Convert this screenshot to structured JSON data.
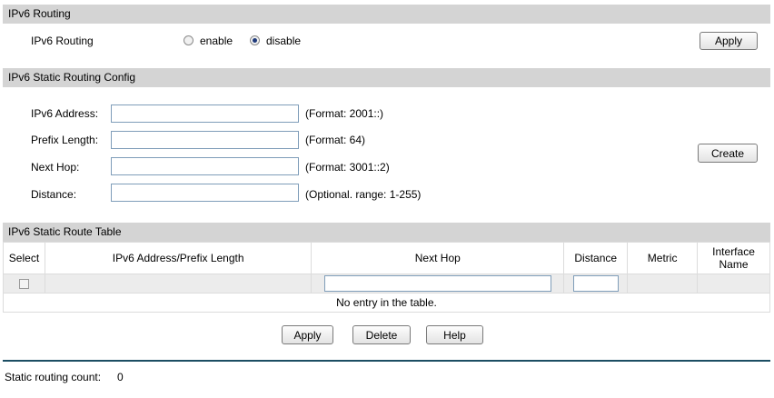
{
  "routing": {
    "section_title": "IPv6 Routing",
    "label": "IPv6 Routing",
    "enable_label": "enable",
    "disable_label": "disable",
    "selected": "disable",
    "apply_label": "Apply"
  },
  "static_config": {
    "section_title": "IPv6 Static Routing Config",
    "fields": [
      {
        "label": "IPv6 Address:",
        "value": "",
        "hint": "(Format: 2001::)"
      },
      {
        "label": "Prefix Length:",
        "value": "",
        "hint": "(Format: 64)"
      },
      {
        "label": "Next Hop:",
        "value": "",
        "hint": "(Format: 3001::2)"
      },
      {
        "label": "Distance:",
        "value": "",
        "hint": "(Optional. range: 1-255)"
      }
    ],
    "create_label": "Create"
  },
  "route_table": {
    "section_title": "IPv6 Static Route Table",
    "columns": [
      "Select",
      "IPv6 Address/Prefix Length",
      "Next Hop",
      "Distance",
      "Metric",
      "Interface Name"
    ],
    "empty_message": "No entry in the table.",
    "apply_label": "Apply",
    "delete_label": "Delete",
    "help_label": "Help"
  },
  "footer": {
    "count_label": "Static routing count:",
    "count_value": "0"
  }
}
